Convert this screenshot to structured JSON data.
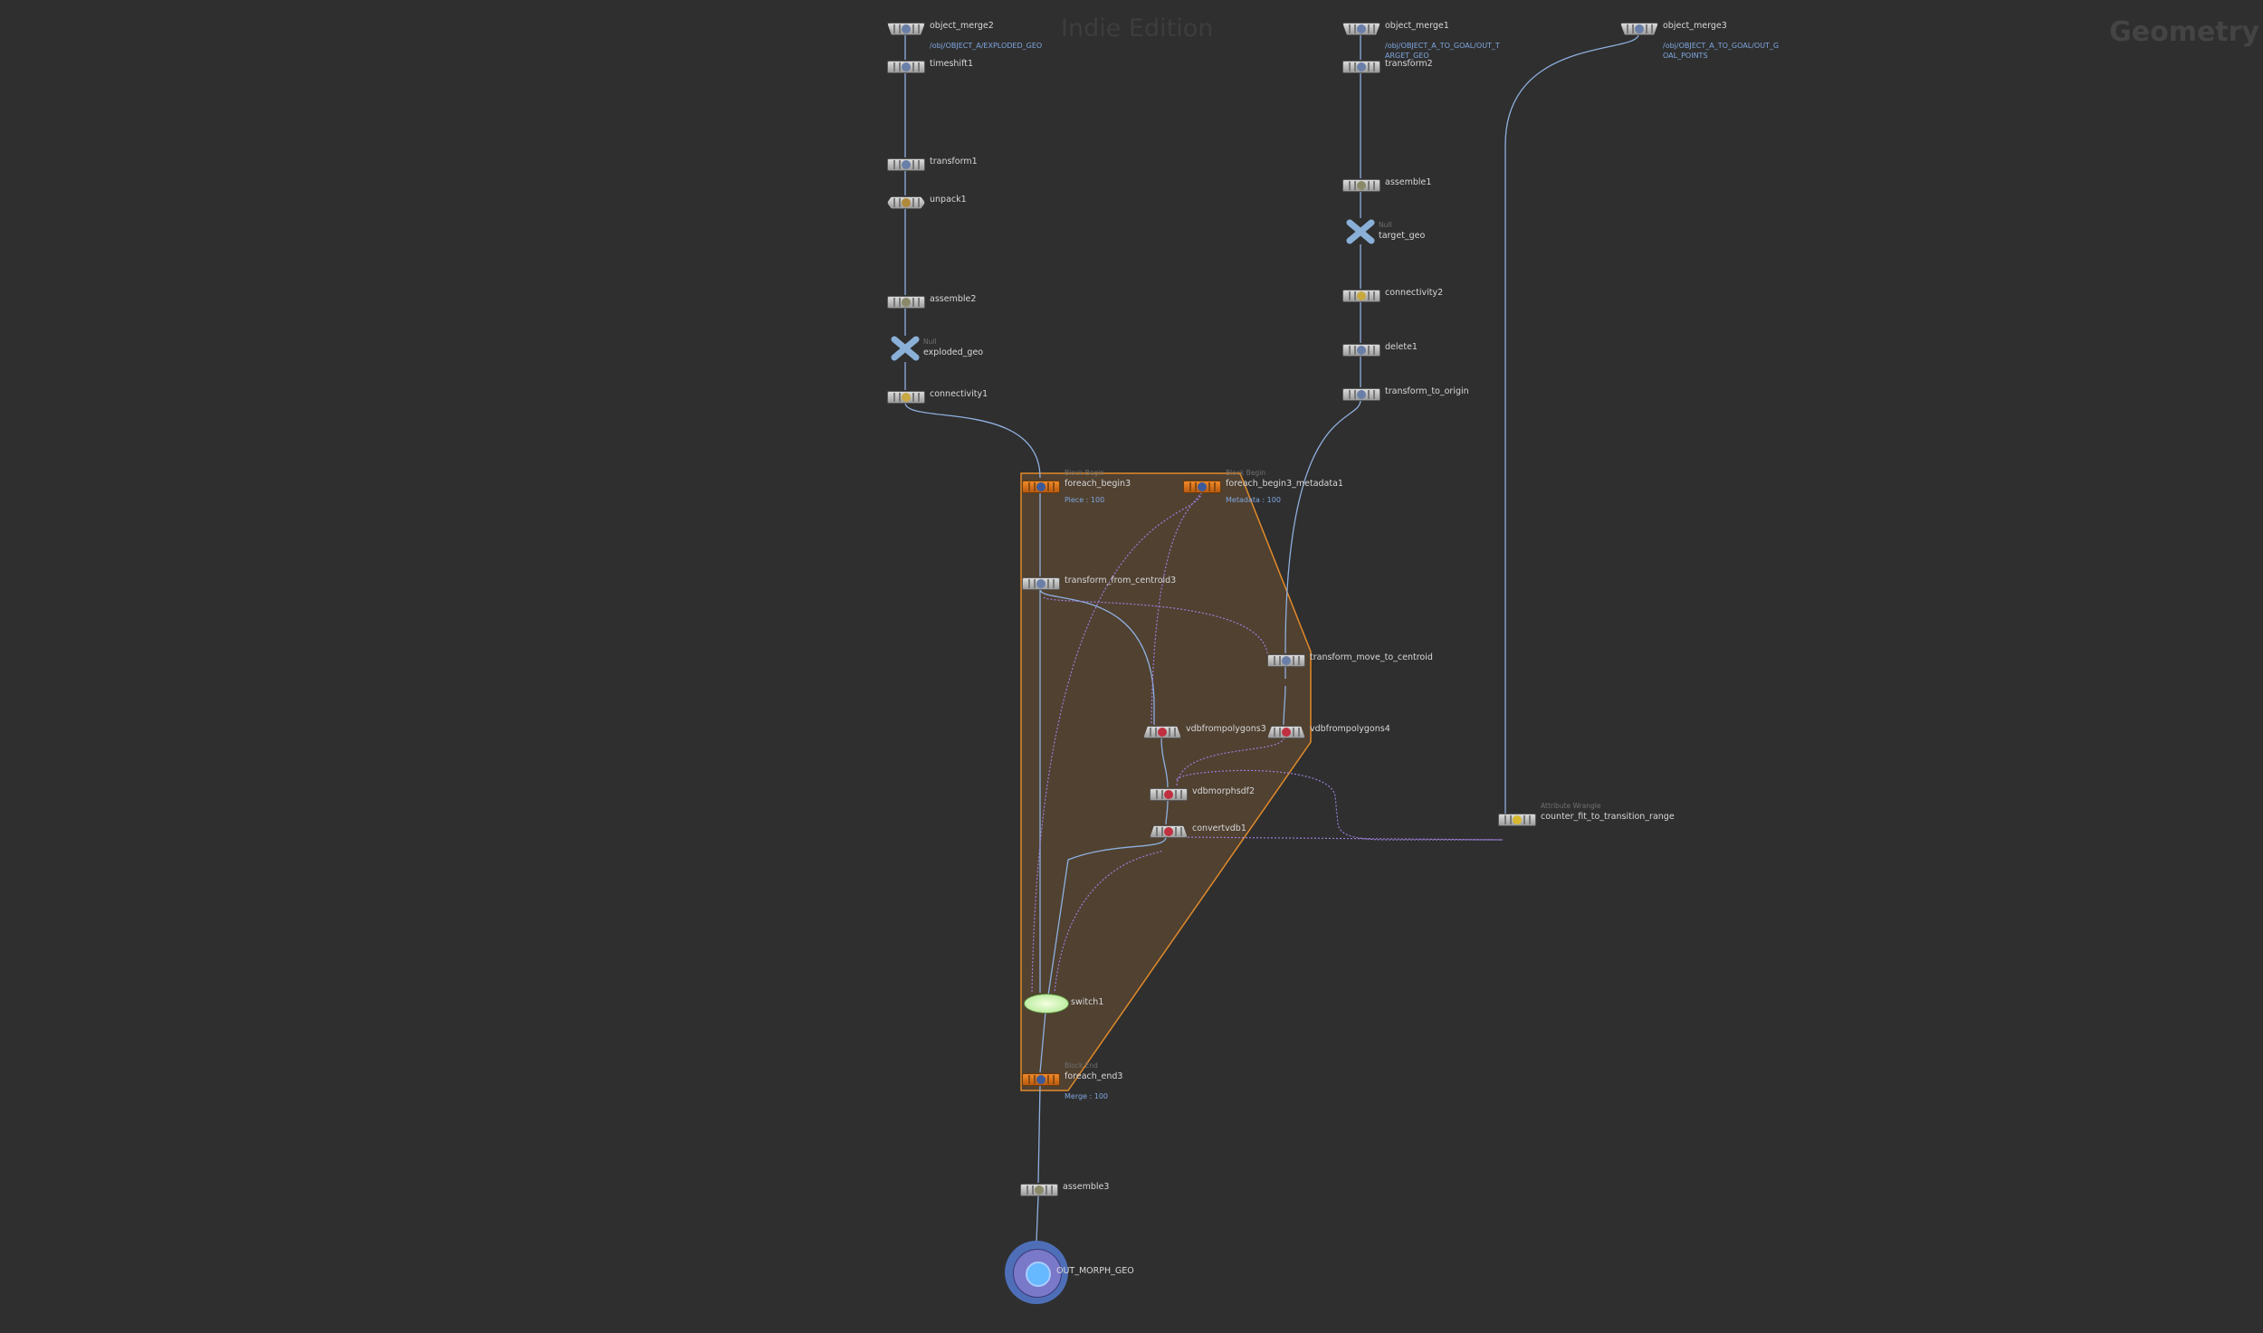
{
  "watermark": {
    "edition": "Indie Edition",
    "context": "Geometry"
  },
  "nodes": {
    "object_merge2": {
      "name": "object_merge2",
      "path": "/obj/OBJECT_A/EXPLODED_GEO"
    },
    "timeshift1": {
      "name": "timeshift1"
    },
    "transform1": {
      "name": "transform1"
    },
    "unpack1": {
      "name": "unpack1"
    },
    "assemble2": {
      "name": "assemble2"
    },
    "exploded_geo": {
      "type": "Null",
      "name": "exploded_geo"
    },
    "connectivity1": {
      "name": "connectivity1"
    },
    "object_merge1": {
      "name": "object_merge1",
      "path_l1": "/obj/OBJECT_A_TO_GOAL/OUT_T",
      "path_l2": "ARGET_GEO"
    },
    "transform2": {
      "name": "transform2"
    },
    "assemble1": {
      "name": "assemble1"
    },
    "target_geo": {
      "type": "Null",
      "name": "target_geo"
    },
    "connectivity2": {
      "name": "connectivity2"
    },
    "delete1": {
      "name": "delete1"
    },
    "transform_to_origin": {
      "name": "transform_to_origin"
    },
    "object_merge3": {
      "name": "object_merge3",
      "path_l1": "/obj/OBJECT_A_TO_GOAL/OUT_G",
      "path_l2": "OAL_POINTS"
    },
    "foreach_begin3": {
      "type": "Block Begin",
      "name": "foreach_begin3",
      "sub": "Piece : 100"
    },
    "foreach_begin3_metadata1": {
      "type": "Block Begin",
      "name": "foreach_begin3_metadata1",
      "sub": "Metadata : 100"
    },
    "transform_from_centroid3": {
      "name": "transform_from_centroid3"
    },
    "transform_move_to_centroid": {
      "name": "transform_move_to_centroid"
    },
    "vdbfrompolygons3": {
      "name": "vdbfrompolygons3"
    },
    "vdbfrompolygons4": {
      "name": "vdbfrompolygons4"
    },
    "vdbmorphsdf2": {
      "name": "vdbmorphsdf2"
    },
    "convertvdb1": {
      "name": "convertvdb1"
    },
    "counter_fit": {
      "type": "Attribute Wrangle",
      "name": "counter_fit_to_transition_range"
    },
    "switch1": {
      "name": "switch1"
    },
    "foreach_end3": {
      "type": "Block End",
      "name": "foreach_end3",
      "sub": "Merge : 100"
    },
    "assemble3": {
      "name": "assemble3"
    },
    "out_morph_geo": {
      "name": "OUT_MORPH_GEO"
    }
  },
  "colors": {
    "background": "#2f2f2f",
    "wire": "#8fb0e0",
    "dotted_wire": "#9a7fd8",
    "block_fill": "#5a4632",
    "block_border": "#e08a2a"
  }
}
